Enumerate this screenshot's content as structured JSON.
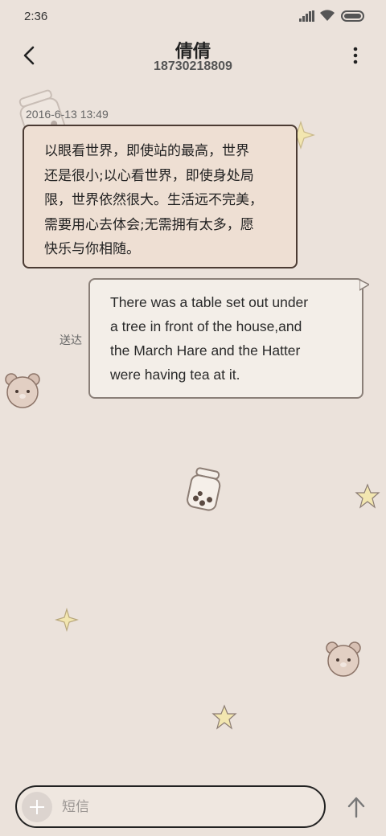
{
  "status_bar": {
    "time": "2:36"
  },
  "header": {
    "title": "倩倩",
    "subtitle": "18730218809"
  },
  "messages": {
    "incoming": {
      "timestamp": "2016-6-13 13:49",
      "lines": [
        "以眼看世界，即使站的最高，世界",
        "还是很小;以心看世界，即使身处局",
        "限，世界依然很大。生活远不完美，",
        "需要用心去体会;无需拥有太多，愿",
        "快乐与你相随。"
      ]
    },
    "outgoing": {
      "lines": [
        "There was a table set out under",
        "a tree in front of the house,and",
        "the March Hare and the Hatter",
        "were having tea at it."
      ],
      "status": "送达"
    }
  },
  "composer": {
    "placeholder": "短信"
  },
  "icons": {
    "back": "back-arrow-icon",
    "more": "more-vertical-icon",
    "add": "plus-icon",
    "send": "send-arrow-up-icon"
  },
  "colors": {
    "background": "#ebe2db",
    "incoming_bubble": "#eedfd3",
    "outgoing_bubble": "#f3eee8"
  }
}
